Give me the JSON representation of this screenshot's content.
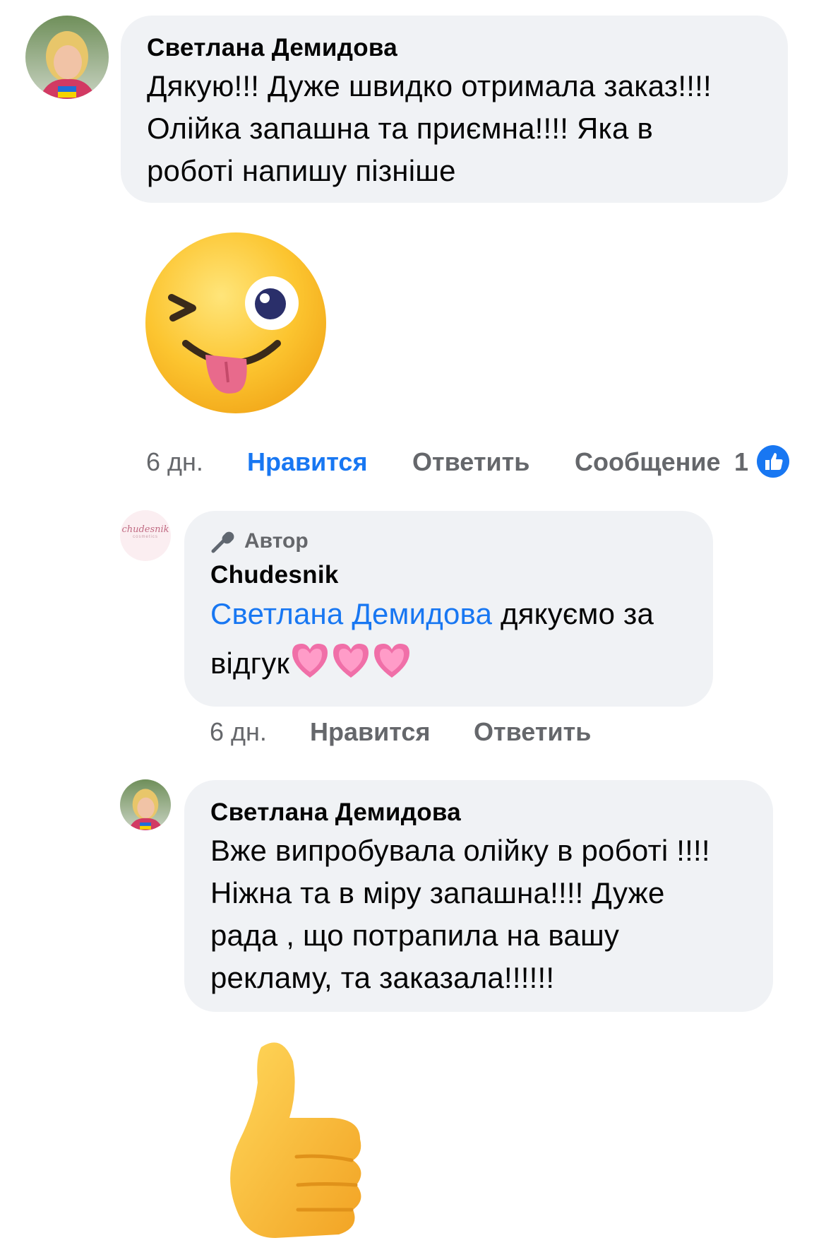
{
  "comments": [
    {
      "author": "Светлана Демидова",
      "text": "Дякую!!! Дуже швидко отримала заказ!!!! Олійка запашна та приємна!!!! Яка в роботі напишу пізніше",
      "lines": [
        "Дякую!!! Дуже швидко отримала заказ!!!!",
        "Олійка запашна та приємна!!!! Яка в",
        "роботі напишу пізніше"
      ],
      "sticker": "winking-tongue-emoji",
      "meta": {
        "time": "6 дн.",
        "like": "Нравится",
        "reply": "Ответить",
        "message": "Сообщение",
        "reactions": "1"
      },
      "avatar_icon": "user-photo-avatar"
    },
    {
      "badge": "Автор",
      "author": "Chudesnik",
      "avatar_logo_text": "chudesnik",
      "avatar_logo_subtext": "cosmetics",
      "mention": "Светлана Демидова",
      "text_line1": "дякуємо за",
      "text_line2": "відгук",
      "hearts": [
        "💗",
        "💗",
        "💗"
      ],
      "meta": {
        "time": "6 дн.",
        "like": "Нравится",
        "reply": "Ответить"
      }
    },
    {
      "author": "Светлана Демидова",
      "text": "Вже випробувала олійку в роботі !!!! Ніжна та в міру запашна!!!! Дуже рада , що потрапила на вашу рекламу, та заказала!!!!!!",
      "lines": [
        "Вже випробувала олійку в роботі !!!!",
        "Ніжна та в міру запашна!!!! Дуже",
        "рада , що потрапила на вашу",
        "рекламу, та заказала!!!!!!"
      ],
      "sticker": "thumbs-up-emoji"
    }
  ],
  "colors": {
    "bubble": "#f0f2f5",
    "link": "#1877f2",
    "meta": "#65676b",
    "text": "#050505"
  }
}
